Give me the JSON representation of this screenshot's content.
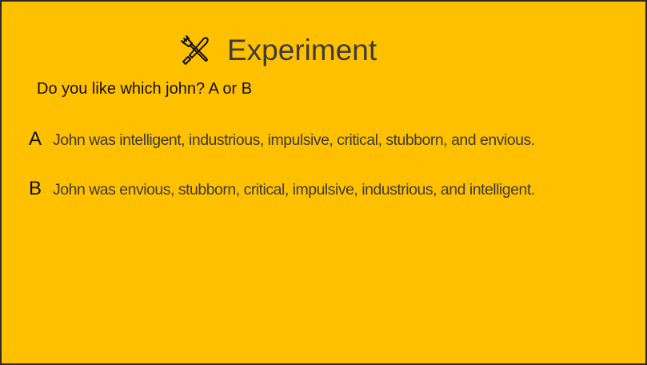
{
  "slide": {
    "title": "Experiment",
    "title_icon": "utensils-icon",
    "question": "Do you like which john? A or B",
    "options": [
      {
        "letter": "A",
        "text": "John was intelligent, industrious, impulsive, critical, stubborn, and envious."
      },
      {
        "letter": "B",
        "text": "John was envious, stubborn, critical, impulsive, industrious, and intelligent."
      }
    ]
  },
  "colors": {
    "background": "#FFC000",
    "title_text": "#3c3c3c",
    "body_text": "#111111",
    "frame": "#2a2a2a"
  }
}
